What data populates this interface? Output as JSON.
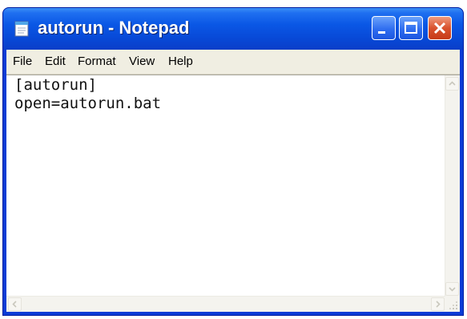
{
  "window": {
    "title": "autorun - Notepad",
    "app_icon": "notepad-icon",
    "controls": [
      "minimize-icon",
      "maximize-icon",
      "close-icon"
    ],
    "accent_color": "#0a57e5",
    "close_color": "#d9532e"
  },
  "menu": {
    "file": "File",
    "edit": "Edit",
    "format": "Format",
    "view": "View",
    "help": "Help"
  },
  "editor": {
    "line_1": "[autorun]",
    "line_2": "open=autorun.bat"
  },
  "scrollbars": {
    "icons": [
      "arrow-up-icon",
      "arrow-down-icon",
      "arrow-left-icon",
      "arrow-right-icon",
      "resize-grip-icon"
    ]
  }
}
